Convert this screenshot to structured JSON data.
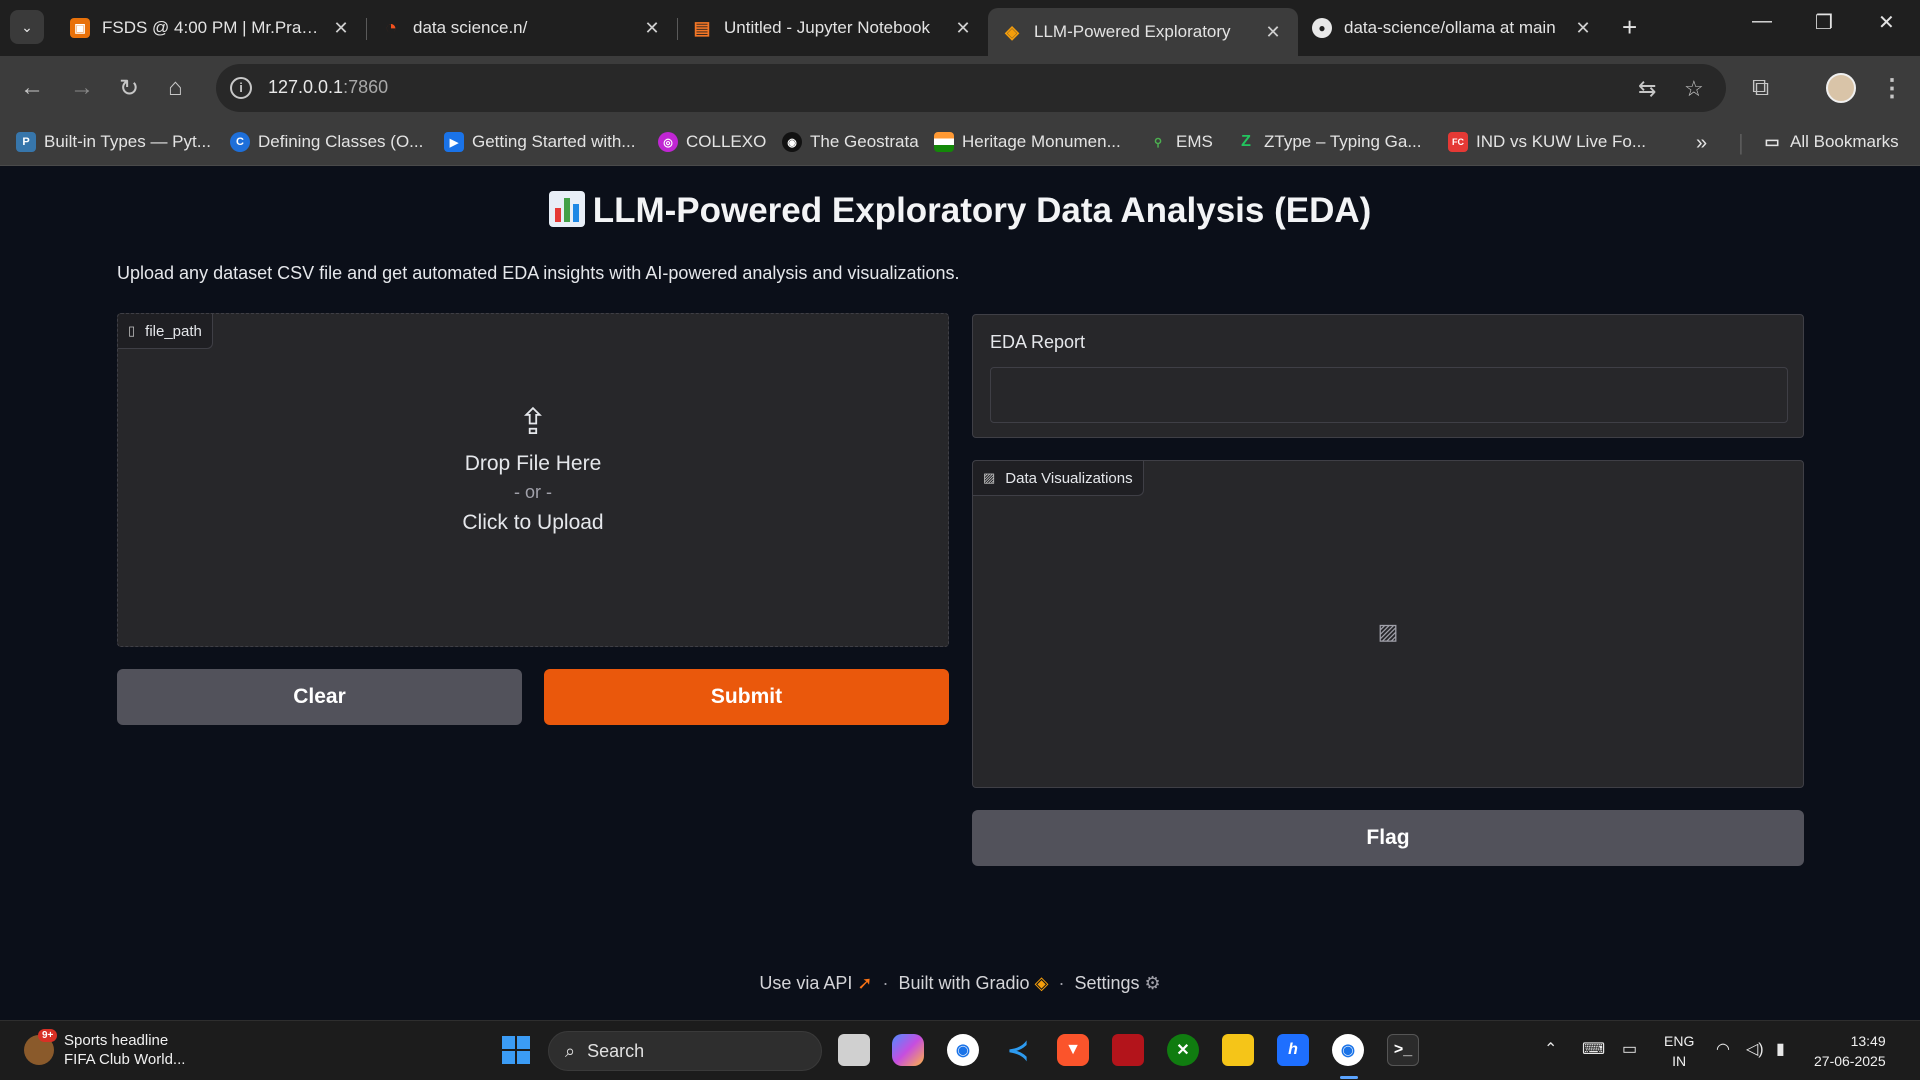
{
  "browser": {
    "tabs": [
      {
        "title": "FSDS @ 4:00 PM | Mr.Prakash",
        "close": "✕",
        "fav_color": "#e8710a",
        "fav_glyph": "▣"
      },
      {
        "title": "data science.n/",
        "close": "✕",
        "fav_color": "#f4511e",
        "fav_glyph": "◔"
      },
      {
        "title": "Untitled - Jupyter Notebook",
        "close": "✕",
        "fav_color": "#f37626",
        "fav_glyph": "▤"
      },
      {
        "title": "LLM-Powered Exploratory",
        "close": "✕",
        "fav_color": "#f59e0b",
        "fav_glyph": "◈"
      },
      {
        "title": "data-science/ollama at main",
        "close": "✕",
        "fav_color": "#e8e8e8",
        "fav_glyph": "●"
      }
    ],
    "new_tab": "+",
    "url_host": "127.0.0.1",
    "url_port": ":7860",
    "bookmarks": [
      {
        "label": "Built-in Types — Pyt...",
        "color": "#3776ab",
        "glyph": "P"
      },
      {
        "label": "Defining Classes (O...",
        "color": "#1e6fd9",
        "glyph": "C"
      },
      {
        "label": "Getting Started with...",
        "color": "#1a73e8",
        "glyph": "▶"
      },
      {
        "label": "COLLEXO",
        "color": "#c026d3",
        "glyph": "◎"
      },
      {
        "label": "The Geostrata",
        "color": "#111111",
        "glyph": "◉"
      },
      {
        "label": "Heritage Monumen...",
        "color": "#ff9933",
        "glyph": "≡"
      },
      {
        "label": "EMS",
        "color": "#2e7d32",
        "glyph": "⚲"
      },
      {
        "label": "ZType – Typing Ga...",
        "color": "#16a34a",
        "glyph": "Z"
      },
      {
        "label": "IND vs KUW Live Fo...",
        "color": "#e53935",
        "glyph": "FC"
      }
    ],
    "more_bookmarks": "»",
    "all_bookmarks": "All Bookmarks"
  },
  "app": {
    "title": "LLM-Powered Exploratory Data Analysis (EDA)",
    "subtitle": "Upload any dataset CSV file and get automated EDA insights with AI-powered analysis and visualizations.",
    "file_input": {
      "label": "file_path",
      "drop_text": "Drop File Here",
      "or_text": "- or -",
      "click_text": "Click to Upload"
    },
    "buttons": {
      "clear": "Clear",
      "submit": "Submit",
      "flag": "Flag"
    },
    "eda_report": {
      "label": "EDA Report",
      "value": ""
    },
    "visualizations": {
      "label": "Data Visualizations"
    },
    "colors": {
      "primary": "#ea580c",
      "secondary": "#52525b",
      "panel": "#27272a",
      "background": "#0b0f19"
    }
  },
  "footer": {
    "api": "Use via API",
    "built": "Built with Gradio",
    "settings": "Settings",
    "separator": "·"
  },
  "taskbar": {
    "news_title": "Sports headline",
    "news_sub": "FIFA Club World...",
    "news_badge": "9+",
    "search": "Search",
    "lang_top": "ENG",
    "lang_bottom": "IN",
    "time": "13:49",
    "date": "27-06-2025"
  }
}
